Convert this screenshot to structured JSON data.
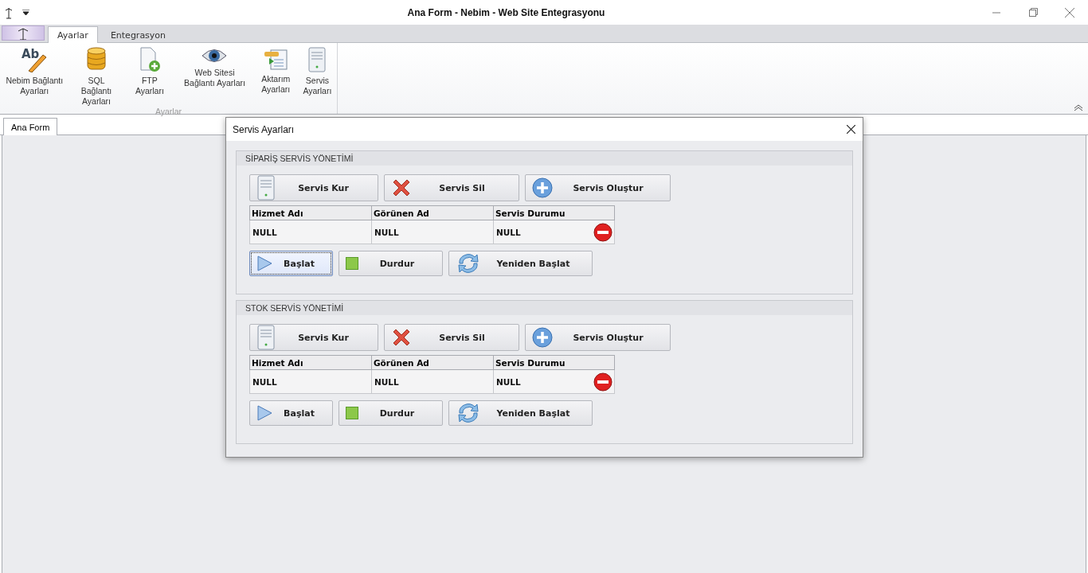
{
  "window": {
    "title": "Ana Form - Nebim - Web Site Entegrasyonu"
  },
  "ribbon_tabs": [
    {
      "label": "Ayarlar",
      "selected": true
    },
    {
      "label": "Entegrasyon",
      "selected": false
    }
  ],
  "ribbon_items": [
    {
      "kind": "pencil",
      "icon_text": "Ab",
      "label": "Nebim Bağlantı Ayarları"
    },
    {
      "kind": "database",
      "label": "SQL Bağlantı Ayarları"
    },
    {
      "kind": "file-add",
      "label": "FTP Ayarları"
    },
    {
      "kind": "eye",
      "label": "Web Sitesi Bağlantı Ayarları"
    },
    {
      "kind": "transfer",
      "label": "Aktarım Ayarları"
    },
    {
      "kind": "server",
      "label": "Servis Ayarları"
    }
  ],
  "ribbon_group": "Ayarlar",
  "document_tabs": [
    {
      "label": "Ana Form",
      "selected": true
    }
  ],
  "dialog": {
    "title": "Servis Ayarları",
    "sections": [
      {
        "title": "SİPARİŞ SERVİS YÖNETİMİ",
        "actions": [
          {
            "kind": "install",
            "label": "Servis Kur"
          },
          {
            "kind": "delete",
            "label": "Servis Sil"
          },
          {
            "kind": "create",
            "label": "Servis Oluştur"
          }
        ],
        "columns": [
          "Hizmet Adı",
          "Görünen Ad",
          "Servis Durumu"
        ],
        "row": [
          "NULL",
          "NULL",
          "NULL"
        ],
        "controls": [
          {
            "kind": "start",
            "label": "Başlat",
            "focused": true
          },
          {
            "kind": "stop",
            "label": "Durdur",
            "focused": false
          },
          {
            "kind": "restart",
            "label": "Yeniden Başlat",
            "focused": false
          }
        ]
      },
      {
        "title": "STOK SERVİS YÖNETİMİ",
        "actions": [
          {
            "kind": "install",
            "label": "Servis Kur"
          },
          {
            "kind": "delete",
            "label": "Servis Sil"
          },
          {
            "kind": "create",
            "label": "Servis Oluştur"
          }
        ],
        "columns": [
          "Hizmet Adı",
          "Görünen Ad",
          "Servis Durumu"
        ],
        "row": [
          "NULL",
          "NULL",
          "NULL"
        ],
        "controls": [
          {
            "kind": "start",
            "label": "Başlat",
            "focused": false
          },
          {
            "kind": "stop",
            "label": "Durdur",
            "focused": false
          },
          {
            "kind": "restart",
            "label": "Yeniden Başlat",
            "focused": false
          }
        ]
      }
    ]
  }
}
